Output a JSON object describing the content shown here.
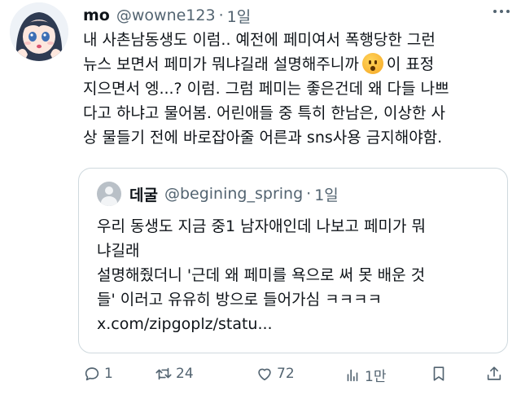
{
  "tweet": {
    "author_name": "mo",
    "handle": "@wowne123",
    "dot": "·",
    "time": "1일",
    "lines": [
      "내 사촌남동생도 이럼.. 예전에 페미여서 폭행당한 그런",
      "뉴스 보면서 페미가 뭐냐길래 설명해주니까",
      "이 표정",
      "지으면서 엥...? 이럼. 그럼 페미는 좋은건데 왜 다들 나쁘",
      "다고 하냐고 물어봄. 어린애들 중 특히 한남은, 이상한 사",
      "상 물들기 전에 바로잡아줄 어른과 sns사용 금지해야함."
    ],
    "emoji": "frowning-face-emoji"
  },
  "quote": {
    "author_name": "데굴",
    "handle": "@begining_spring",
    "dot": "·",
    "time": "1일",
    "lines": [
      "우리 동생도 지금 중1 남자애인데 나보고 페미가 뭐",
      "냐길래",
      "설명해줬더니 '근데 왜 페미를 욕으로 써 못 배운 것",
      "들' 이러고 유유히 방으로 들어가심 ㅋㅋㅋㅋ",
      "x.com/zipgoplz/statu..."
    ]
  },
  "actions": {
    "reply_count": "1",
    "retweet_count": "24",
    "like_count": "72",
    "views_count": "1만",
    "icons": [
      "reply-icon",
      "retweet-icon",
      "like-icon",
      "views-icon",
      "bookmark-icon",
      "share-icon"
    ]
  },
  "colors": {
    "text": "#0f1419",
    "secondary": "#536471",
    "border": "#cfd9de"
  }
}
